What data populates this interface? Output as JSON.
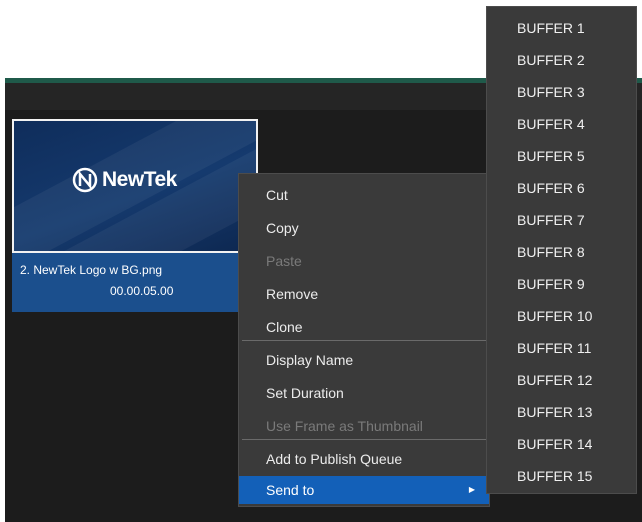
{
  "clip": {
    "name": "2. NewTek Logo w BG.png",
    "duration": "00.00.05.00",
    "logo_text": "NewTek"
  },
  "context_menu": {
    "items": [
      {
        "label": "Cut",
        "enabled": true
      },
      {
        "label": "Copy",
        "enabled": true
      },
      {
        "label": "Paste",
        "enabled": false
      },
      {
        "label": "Remove",
        "enabled": true
      },
      {
        "label": "Clone",
        "enabled": true
      },
      {
        "label": "Display Name",
        "enabled": true
      },
      {
        "label": "Set Duration",
        "enabled": true
      },
      {
        "label": "Use Frame as Thumbnail",
        "enabled": false
      },
      {
        "label": "Add to Publish Queue",
        "enabled": true
      },
      {
        "label": "Send to",
        "enabled": true,
        "highlighted": true,
        "has_submenu": true
      }
    ]
  },
  "buffer_menu": {
    "items": [
      "BUFFER 1",
      "BUFFER 2",
      "BUFFER 3",
      "BUFFER 4",
      "BUFFER 5",
      "BUFFER 6",
      "BUFFER 7",
      "BUFFER 8",
      "BUFFER 9",
      "BUFFER 10",
      "BUFFER 11",
      "BUFFER 12",
      "BUFFER 13",
      "BUFFER 14",
      "BUFFER 15"
    ]
  },
  "colors": {
    "menu_bg": "#3a3a3a",
    "highlight": "#1360b8",
    "app_bg": "#1c1c1c",
    "accent_bar": "#1f5a4a",
    "clip_bg": "#1b4f8d"
  }
}
